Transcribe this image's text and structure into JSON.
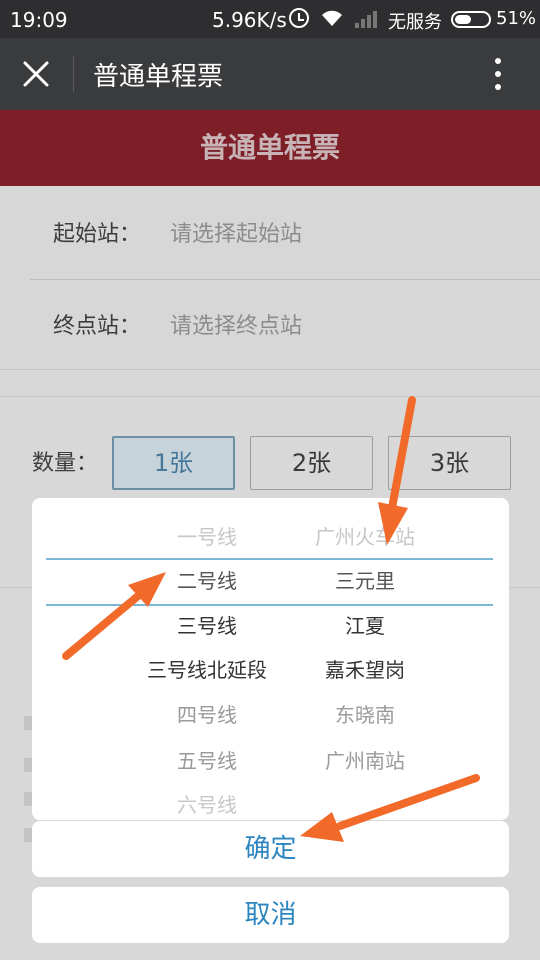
{
  "status_bar": {
    "time": "19:09",
    "net_speed": "5.96K/s",
    "carrier": "无服务",
    "battery": "51%",
    "battery_level": 0.51
  },
  "title_bar": {
    "title": "普通单程票"
  },
  "page": {
    "header": "普通单程票",
    "start_label": "起始站：",
    "start_placeholder": "请选择起始站",
    "end_label": "终点站：",
    "end_placeholder": "请选择终点站",
    "quantity_label": "数量：",
    "quantity_options": [
      "1张",
      "2张",
      "3张"
    ],
    "quantity_selected": "1张"
  },
  "picker": {
    "lines": [
      "一号线",
      "二号线",
      "三号线",
      "三号线北延段",
      "四号线",
      "五号线",
      "六号线"
    ],
    "stations": [
      "广州火车站",
      "三元里",
      "江夏",
      "嘉禾望岗",
      "东晓南",
      "广州南站"
    ],
    "selected_line": "二号线",
    "selected_station": "三元里",
    "confirm_label": "确定",
    "cancel_label": "取消"
  },
  "colors": {
    "header_bg": "#7e1f28",
    "accent": "#2e86c0",
    "arrow": "#f26a2a"
  }
}
